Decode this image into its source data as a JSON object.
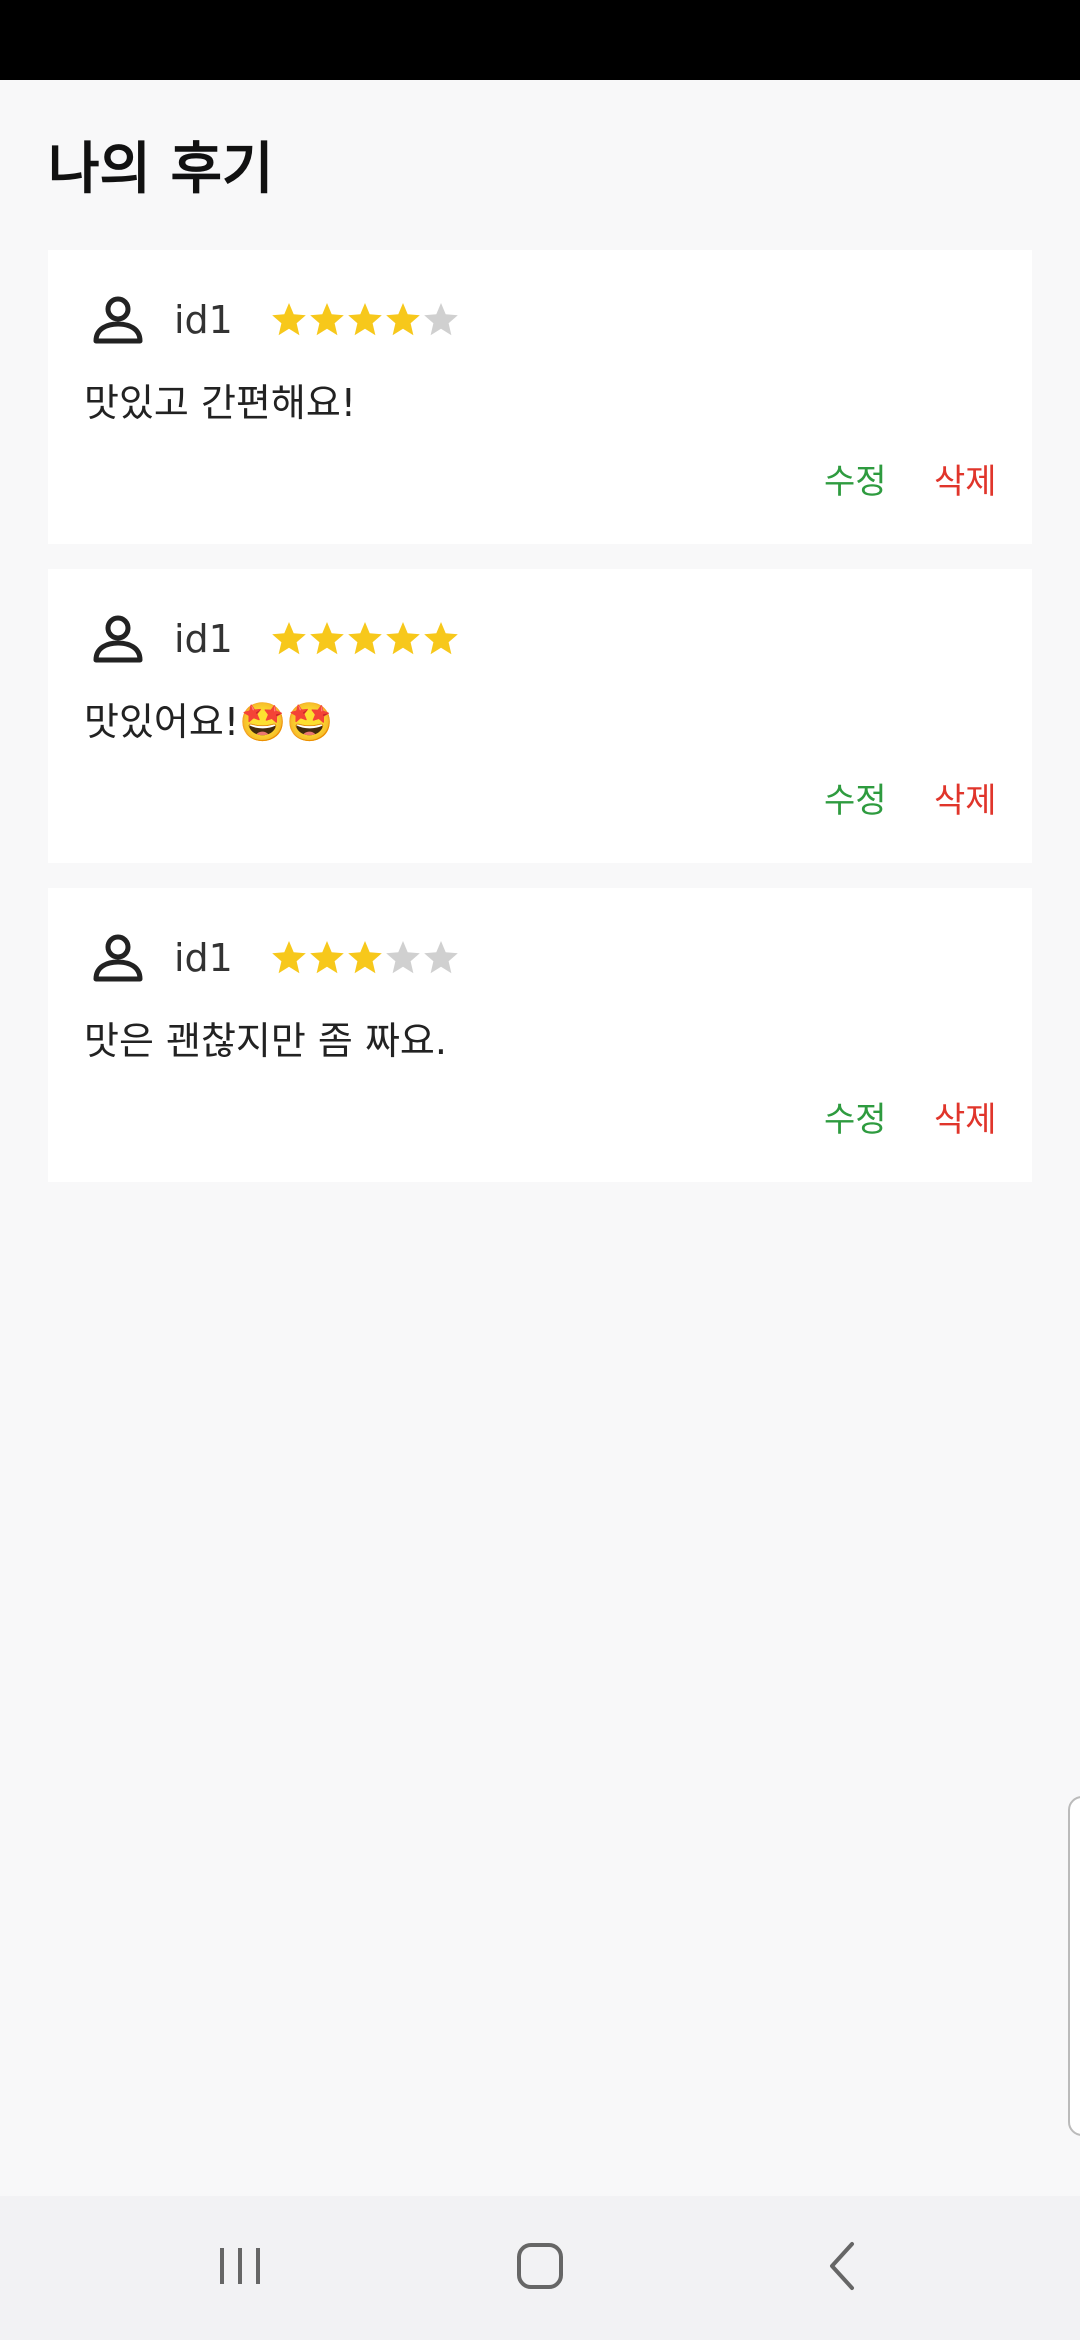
{
  "header": {
    "title": "나의 후기"
  },
  "colors": {
    "star_filled": "#f7c81b",
    "star_empty": "#d0d0d0",
    "edit": "#2e9b3f",
    "delete": "#e0352b"
  },
  "reviews": [
    {
      "user_id": "id1",
      "rating": 4,
      "max_rating": 5,
      "text": "맛있고 간편해요!",
      "edit_label": "수정",
      "delete_label": "삭제"
    },
    {
      "user_id": "id1",
      "rating": 5,
      "max_rating": 5,
      "text": "맛있어요!🤩🤩",
      "edit_label": "수정",
      "delete_label": "삭제"
    },
    {
      "user_id": "id1",
      "rating": 3,
      "max_rating": 5,
      "text": "맛은 괜찮지만 좀 짜요.",
      "edit_label": "수정",
      "delete_label": "삭제"
    }
  ],
  "nav": {
    "icons": [
      "recent-apps-icon",
      "home-icon",
      "back-icon"
    ]
  }
}
